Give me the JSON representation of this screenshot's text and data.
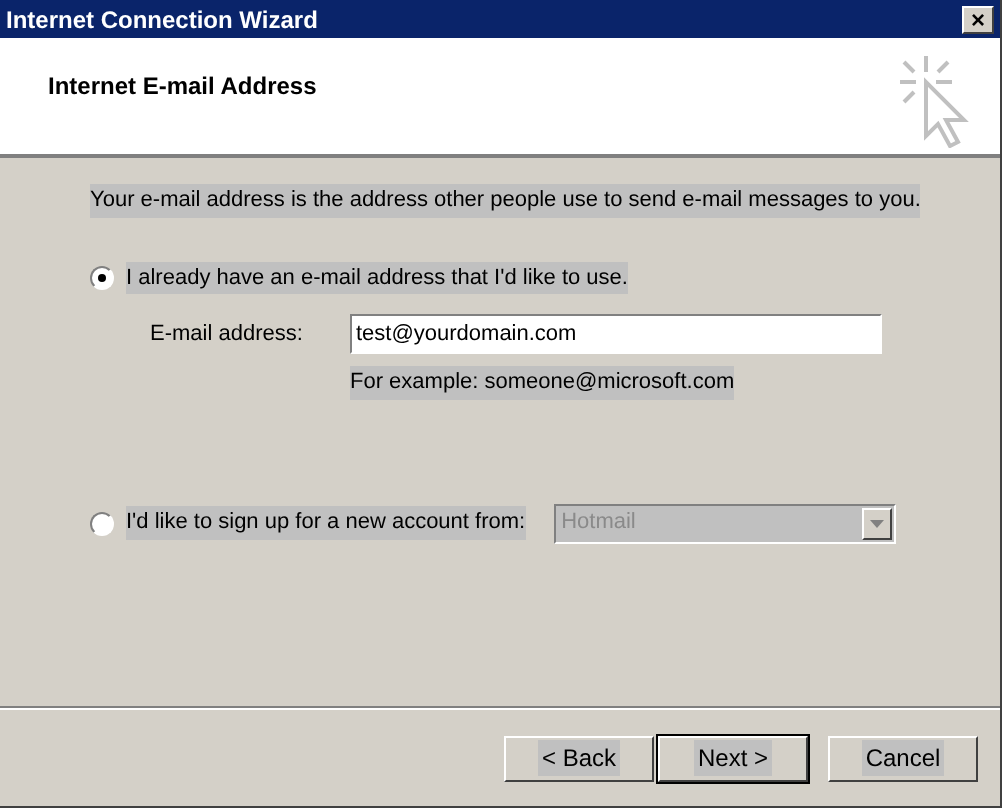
{
  "window": {
    "title": "Internet Connection Wizard",
    "close": "×"
  },
  "header": {
    "title": "Internet E-mail Address"
  },
  "description": "Your e-mail address is the address other people use to send e-mail messages to you.",
  "options": [
    {
      "kind": "existing",
      "label": "I already have an e-mail address that I'd like to use.",
      "selected": true,
      "field_label": "E-mail address:",
      "value": "test@yourdomain.com",
      "example": "For example: someone@microsoft.com"
    },
    {
      "kind": "signup",
      "label": "I'd like to sign up for a new account from:",
      "selected": false,
      "dropdown": {
        "value": "Hotmail",
        "disabled": true
      }
    }
  ],
  "buttons": [
    {
      "label": "< Back",
      "default": false
    },
    {
      "label": "Next >",
      "default": true
    },
    {
      "label": "Cancel",
      "default": false
    }
  ]
}
